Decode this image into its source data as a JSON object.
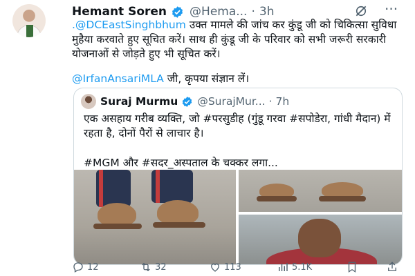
{
  "tweet": {
    "author_name": "Hemant Soren",
    "handle": "@Hema...",
    "separator": "·",
    "time": "3h",
    "body_lines": [
      {
        "mention": ".@DCEastSinghbhum",
        "text": " उक्त मामले की जांच कर कुंडू जी को चिकित्सा सुविधा मुहैया करवाते हुए सूचित करें। साथ ही कुंडू जी के परिवार को सभी जरूरी सरकारी योजनाओं से जोड़ते हुए भी सूचित करें।"
      }
    ],
    "mention_line": {
      "mention": "@IrfanAnsariMLA",
      "text": " जी, कृपया संज्ञान लें।"
    }
  },
  "quote": {
    "author_name": "Suraj Murmu",
    "handle": "@SurajMur...",
    "separator": "·",
    "time": "7h",
    "text": "एक असहाय गरीब व्यक्ति, जो #परसुडीह (गुंडू गरवा #सपोडेरा, गांधी मैदान) में रहता है, दोनों पैरों से लाचार है।",
    "text2": "#MGM और #सदर_अस्पताल के चक्कर लगा..."
  },
  "actions": {
    "replies": "12",
    "retweets": "32",
    "likes": "113",
    "views": "5.1K"
  },
  "icons": {
    "verified": "verified-badge-icon",
    "grok": "grok-icon",
    "more": "more-icon",
    "reply": "reply-icon",
    "retweet": "retweet-icon",
    "like": "heart-icon",
    "views": "views-icon",
    "bookmark": "bookmark-icon",
    "share": "share-icon"
  },
  "colors": {
    "accent": "#1d9bf0",
    "muted": "#536471",
    "text": "#0f1419"
  }
}
